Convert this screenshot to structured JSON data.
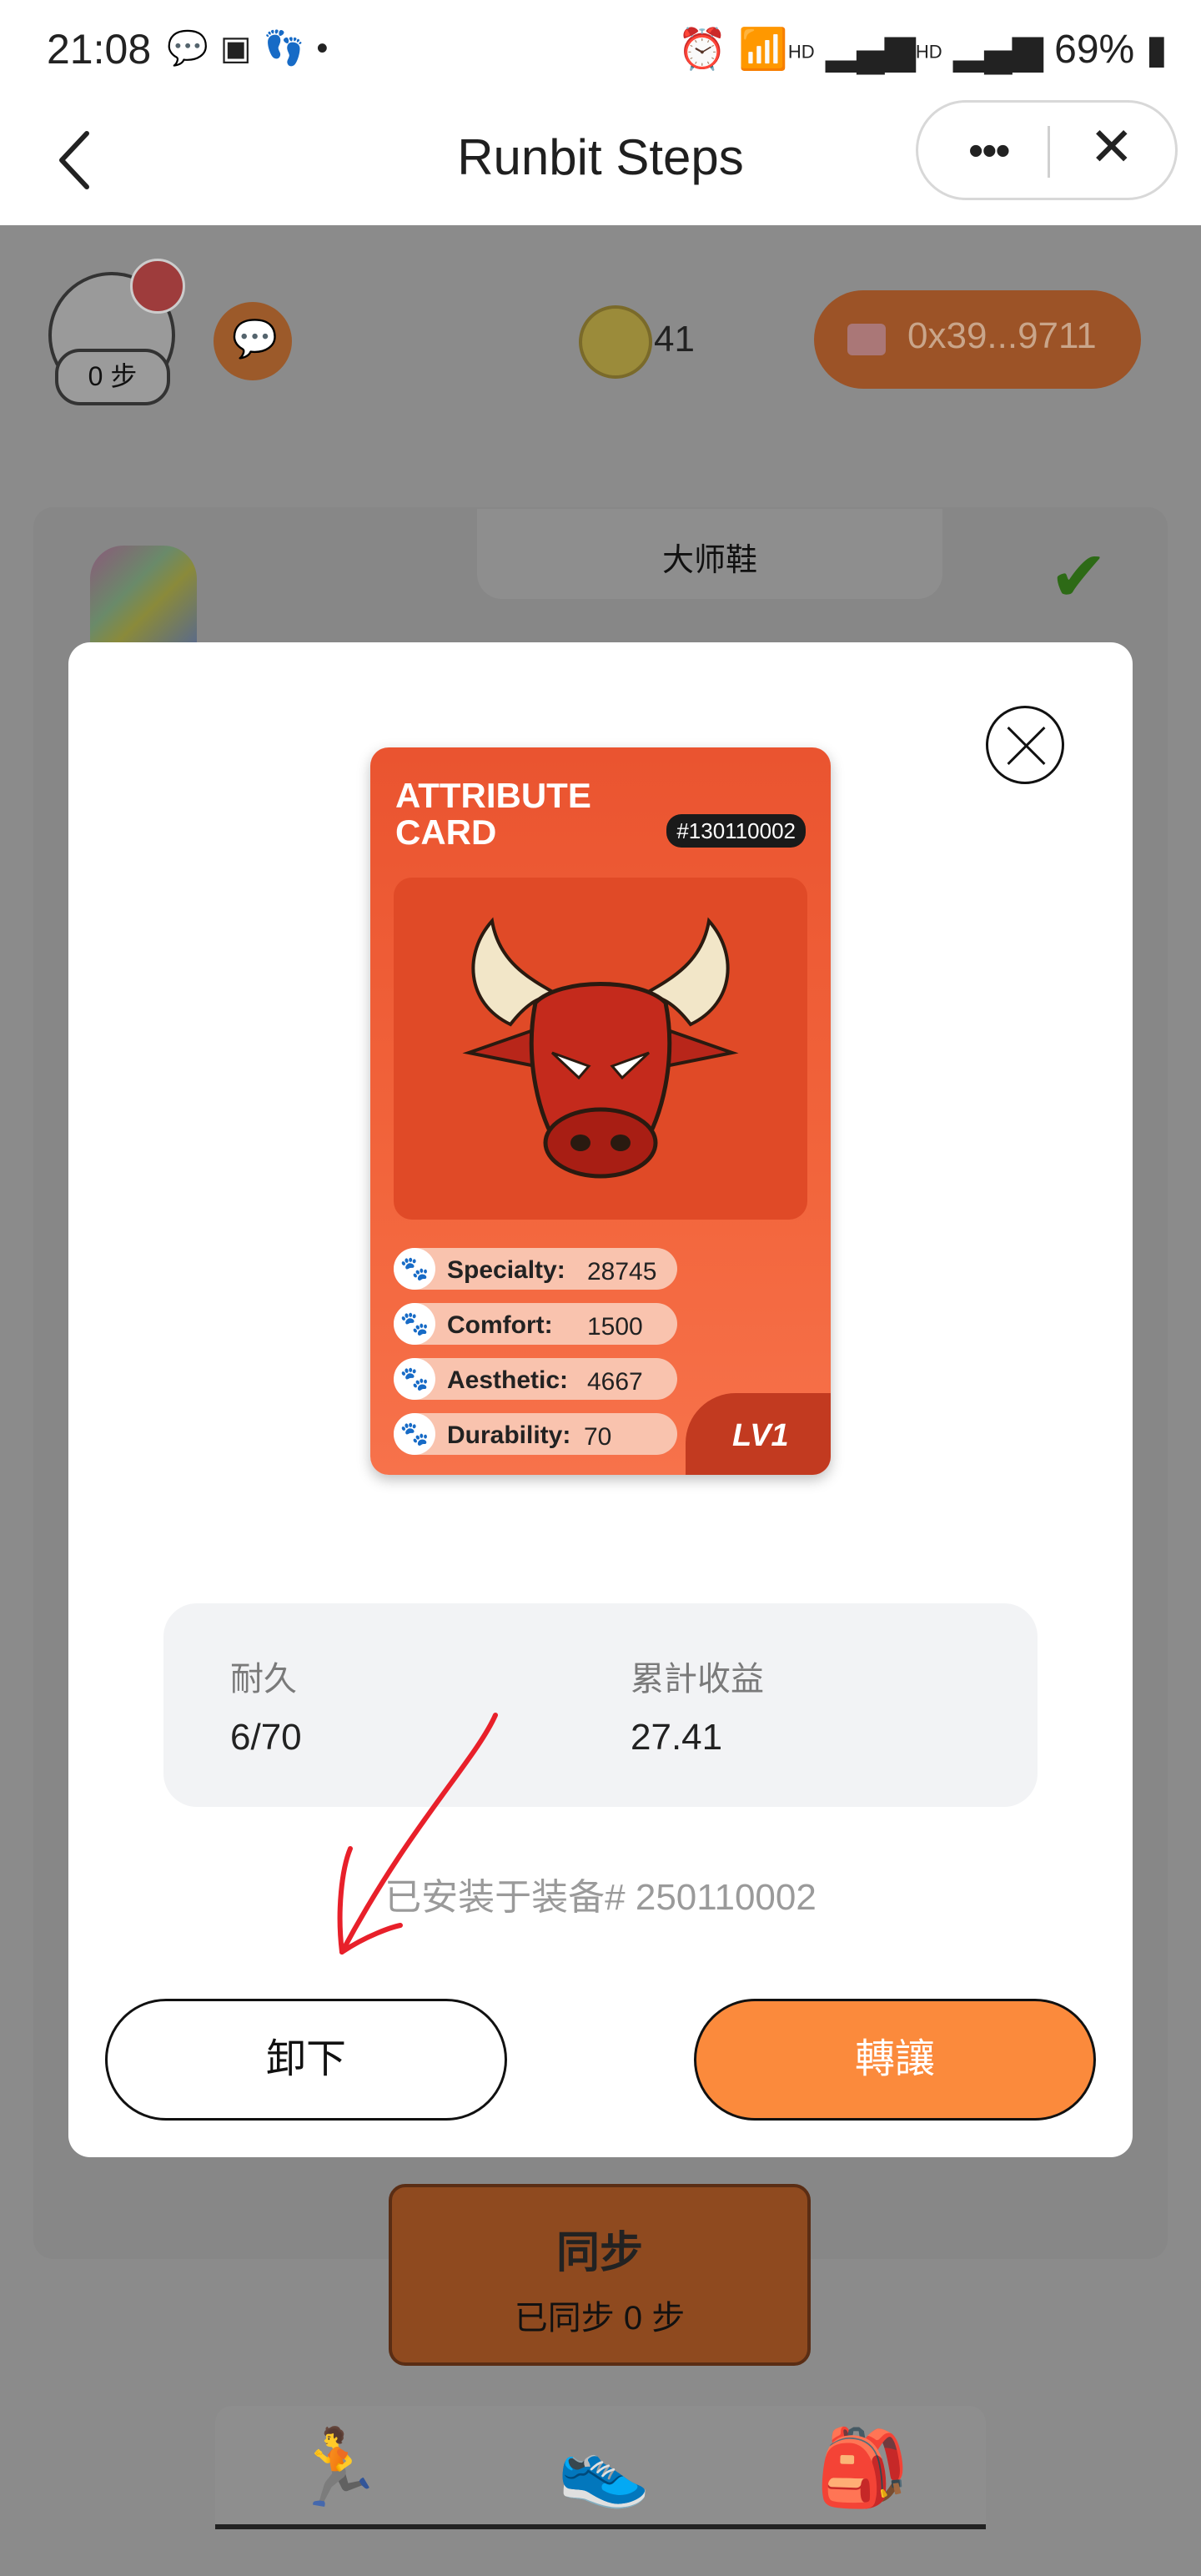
{
  "status_bar": {
    "time": "21:08",
    "left_icons": [
      "wechat-icon",
      "gallery-icon",
      "steps-icon",
      "dot-icon"
    ],
    "right_icons": [
      "alarm-icon",
      "wifi-icon",
      "signal-icon",
      "signal-icon",
      "battery-icon"
    ],
    "hd1": "HD",
    "hd2": "HD",
    "battery": "69%"
  },
  "header": {
    "title": "Runbit Steps",
    "more_label": "•••",
    "close_label": "✕"
  },
  "app": {
    "steps_badge": "0 步",
    "coin_count": "41",
    "wallet_address": "0x39...9711",
    "shoe_tab_label": "大师鞋",
    "sync": {
      "title": "同步",
      "subtitle": "已同步 0 步"
    },
    "tabs": [
      "run-icon",
      "shoe-icon",
      "backpack-icon"
    ]
  },
  "modal": {
    "card": {
      "title_line1": "ATTRIBUTE",
      "title_line2": "CARD",
      "id": "#130110002",
      "level": "LV1",
      "stats": [
        {
          "label": "Specialty:",
          "value": "28745"
        },
        {
          "label": "Comfort:",
          "value": "1500"
        },
        {
          "label": "Aesthetic:",
          "value": "4667"
        },
        {
          "label": "Durability:",
          "value": "70"
        }
      ]
    },
    "info": {
      "durability_label": "耐久",
      "durability_value": "6/70",
      "earnings_label": "累計收益",
      "earnings_value": "27.41"
    },
    "installed_text": "已安装于装备# 250110002",
    "unload_label": "卸下",
    "transfer_label": "轉讓"
  },
  "colors": {
    "accent_orange": "#fb8a3c",
    "card_red": "#ea5430",
    "overlay": "#8a8a8a"
  }
}
